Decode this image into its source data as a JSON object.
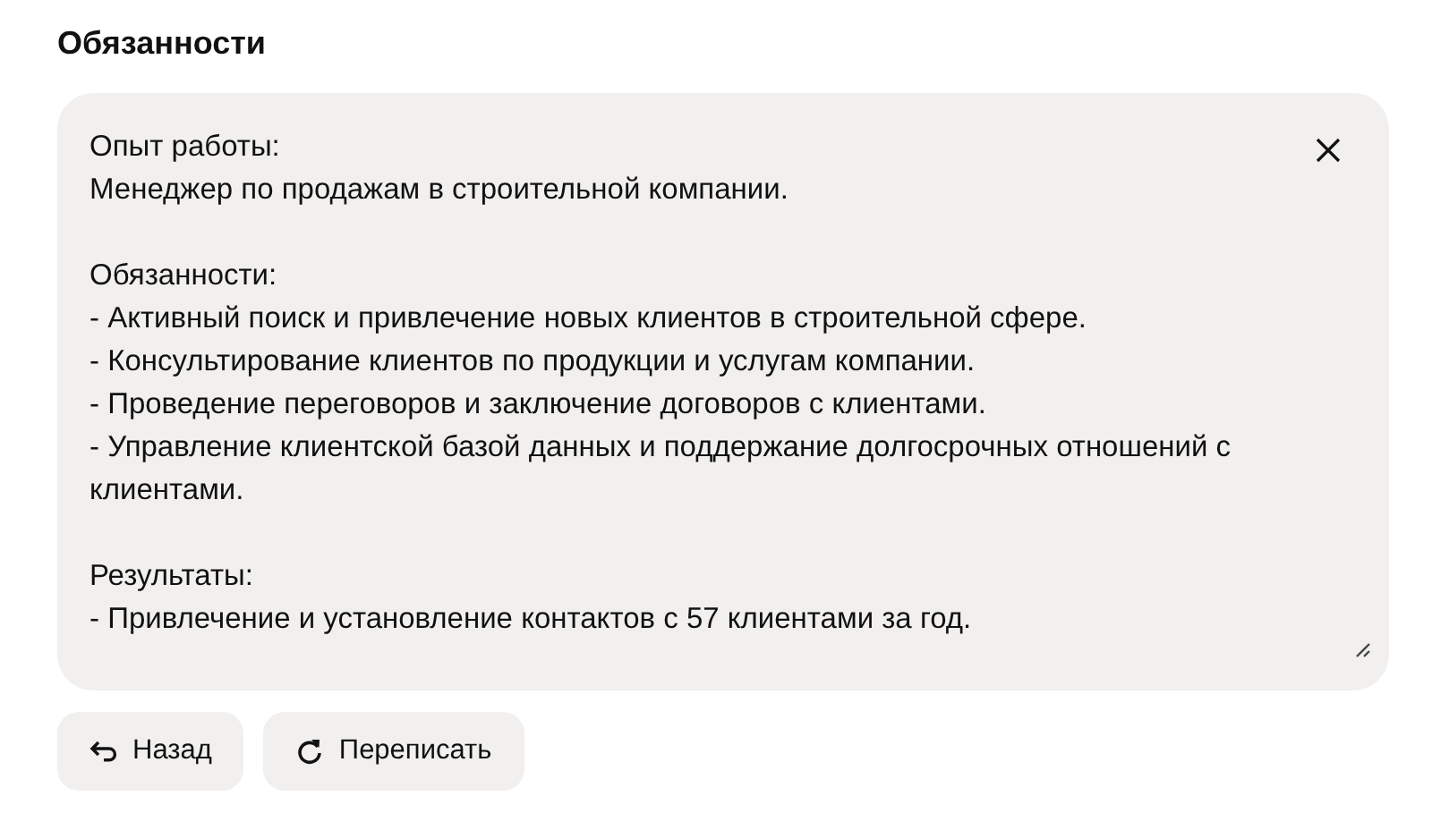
{
  "heading": "Обязанности",
  "editor": {
    "value": "Опыт работы:\nМенеджер по продажам в строительной компании.\n\nОбязанности:\n- Активный поиск и привлечение новых клиентов в строительной сфере.\n- Консультирование клиентов по продукции и услугам компании.\n- Проведение переговоров и заключение договоров с клиентами.\n- Управление клиентской базой данных и поддержание долгосрочных отношений с клиентами.\n\nРезультаты:\n- Привлечение и установление контактов с 57 клиентами за год."
  },
  "buttons": [
    {
      "kind": "back",
      "label": "Назад"
    },
    {
      "kind": "rewrite",
      "label": "Переписать"
    }
  ]
}
